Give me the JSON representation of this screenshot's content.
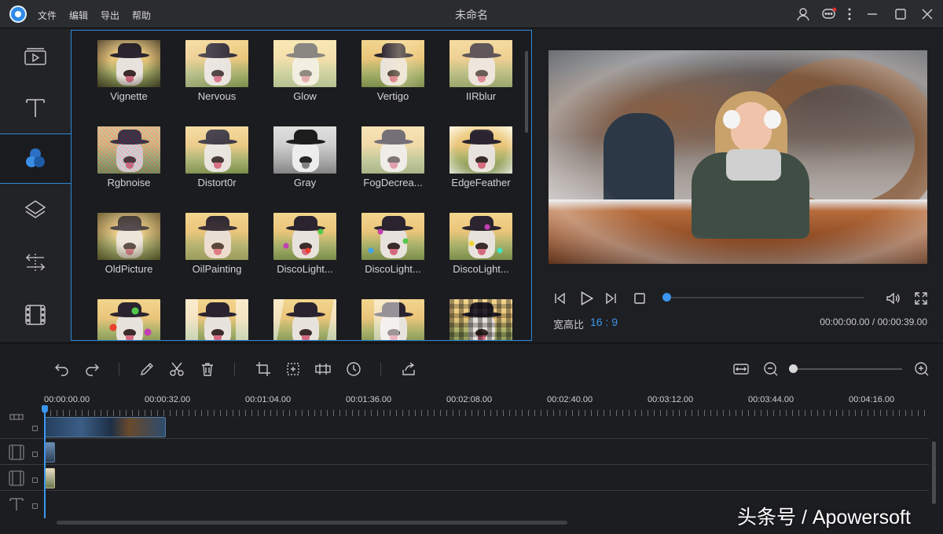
{
  "menu": {
    "file": "文件",
    "edit": "编辑",
    "export": "导出",
    "help": "帮助"
  },
  "window": {
    "title": "未命名"
  },
  "effects": [
    "Vignette",
    "Nervous",
    "Glow",
    "Vertigo",
    "IIRblur",
    "Rgbnoise",
    "Distort0r",
    "Gray",
    "FogDecrea...",
    "EdgeFeather",
    "OldPicture",
    "OilPainting",
    "DiscoLight...",
    "DiscoLight...",
    "DiscoLight...",
    "",
    "",
    "",
    "",
    ""
  ],
  "player": {
    "ratio_label": "宽高比",
    "ratio_value": "16 : 9",
    "time": "00:00:00.00 / 00:00:39.00",
    "progress": 0
  },
  "timeline": {
    "ticks": [
      "00:00:00.00",
      "00:00:32.00",
      "00:01:04.00",
      "00:01:36.00",
      "00:02:08.00",
      "00:02:40.00",
      "00:03:12.00",
      "00:03:44.00",
      "00:04:16.00"
    ]
  },
  "watermark": "头条号 / Apowersoft",
  "colors": {
    "accent": "#3a96f0",
    "bg": "#1e1f22",
    "panel": "#2b2c30"
  }
}
